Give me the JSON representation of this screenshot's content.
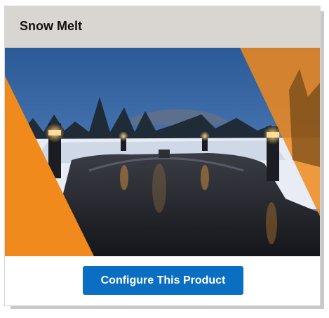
{
  "card": {
    "title": "Snow Melt",
    "image_subject": "snow-melted-driveway-photo",
    "button_label": "Configure This Product"
  },
  "colors": {
    "header_bg": "#d9d5d0",
    "accent_orange": "#f08a1c",
    "button_blue": "#0a6fc2"
  }
}
